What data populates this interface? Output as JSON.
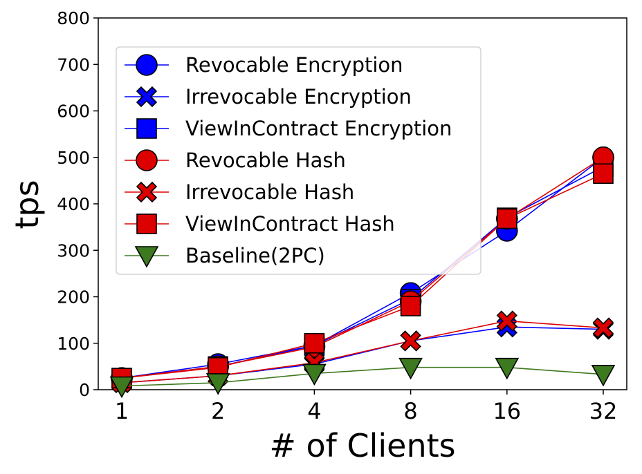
{
  "chart_data": {
    "type": "line",
    "title": "",
    "xlabel": "# of Clients",
    "ylabel": "tps",
    "x_scale": "log2",
    "categories": [
      "1",
      "2",
      "4",
      "8",
      "16",
      "32"
    ],
    "x": [
      1,
      2,
      4,
      8,
      16,
      32
    ],
    "ylim": [
      0,
      800
    ],
    "yticks": [
      0,
      100,
      200,
      300,
      400,
      500,
      600,
      700,
      800
    ],
    "grid": false,
    "legend_position": "upper-left",
    "series": [
      {
        "name": "Revocable Encryption",
        "values": [
          25,
          55,
          95,
          208,
          342,
          500
        ],
        "color": "#0000ff",
        "marker": "circle",
        "marker_color": "#0000ff"
      },
      {
        "name": "Irrevocable Encryption",
        "values": [
          15,
          30,
          55,
          105,
          135,
          130
        ],
        "color": "#0000ff",
        "marker": "x",
        "marker_color": "#0000ff"
      },
      {
        "name": "ViewInContract Encryption",
        "values": [
          25,
          50,
          95,
          195,
          370,
          480
        ],
        "color": "#0000ff",
        "marker": "square",
        "marker_color": "#0000ff"
      },
      {
        "name": "Revocable Hash",
        "values": [
          25,
          50,
          92,
          190,
          368,
          500
        ],
        "color": "#dd0000",
        "marker": "circle",
        "marker_color": "#dd0000"
      },
      {
        "name": "Irrevocable Hash",
        "values": [
          15,
          30,
          58,
          105,
          148,
          133
        ],
        "color": "#dd0000",
        "marker": "x",
        "marker_color": "#dd0000"
      },
      {
        "name": "ViewInContract Hash",
        "values": [
          25,
          48,
          100,
          180,
          368,
          465
        ],
        "color": "#dd0000",
        "marker": "square",
        "marker_color": "#dd0000"
      },
      {
        "name": "Baseline(2PC)",
        "values": [
          8,
          15,
          35,
          48,
          48,
          33
        ],
        "color": "#3d7a1f",
        "marker": "triangle-down",
        "marker_color": "#3d7a1f"
      }
    ]
  }
}
